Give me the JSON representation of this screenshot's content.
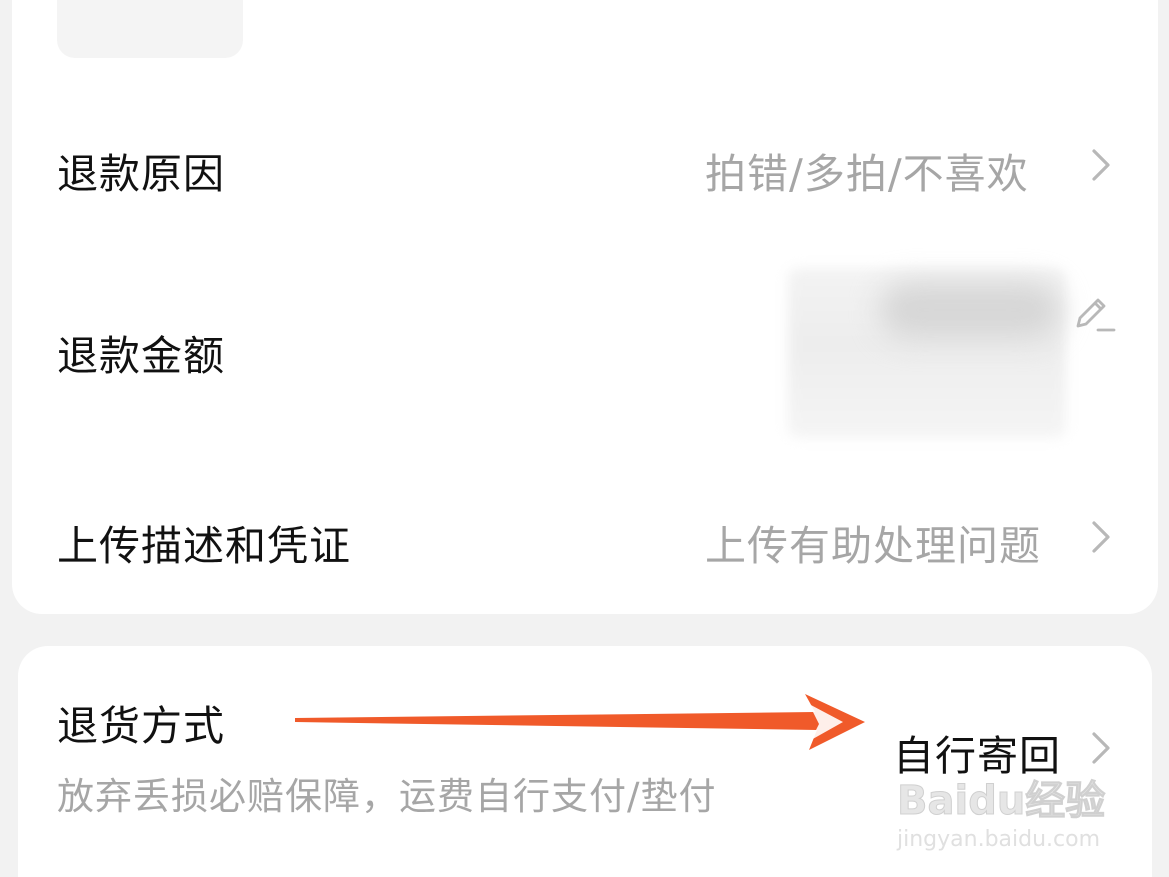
{
  "refund_form": {
    "reason": {
      "label": "退款原因",
      "value": "拍错/多拍/不喜欢"
    },
    "amount": {
      "label": "退款金额"
    },
    "upload": {
      "label": "上传描述和凭证",
      "placeholder": "上传有助处理问题"
    }
  },
  "return_method": {
    "label": "退货方式",
    "description": "放弃丢损必赔保障，运费自行支付/垫付",
    "value": "自行寄回"
  },
  "watermark": {
    "brand": "Baidu经验",
    "url": "jingyan.baidu.com"
  },
  "colors": {
    "text": "#111111",
    "muted": "#a6a6a6",
    "arrow": "#f05a2a",
    "background": "#f2f2f2",
    "card": "#ffffff"
  },
  "icons": {
    "chevron": "chevron-right-icon",
    "edit": "pencil-icon"
  }
}
